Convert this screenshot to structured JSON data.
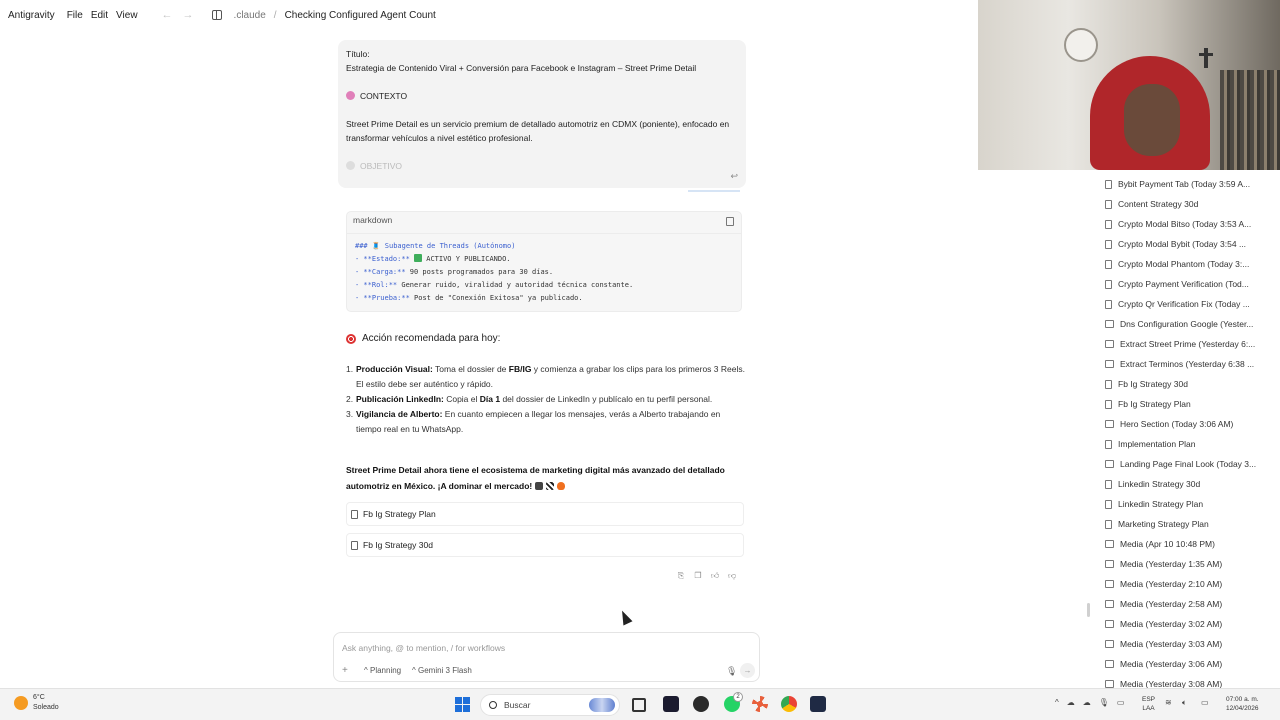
{
  "topbar": {
    "brand": "Antigravity",
    "menu": [
      "File",
      "Edit",
      "View"
    ],
    "breadcrumb_root": ".claude",
    "breadcrumb_sep": "/",
    "breadcrumb_current": "Checking Configured Agent Count"
  },
  "prompt": {
    "title_label": "Título:",
    "title_text": "Estrategia de Contenido Viral + Conversión para Facebook e Instagram – Street Prime Detail",
    "context_label": "CONTEXTO",
    "context_text": "Street Prime Detail es un servicio premium de detallado automotriz en CDMX (poniente), enfocado en transformar vehículos a nivel estético profesional.",
    "next_label": "OBJETIVO"
  },
  "code_block": {
    "lang": "markdown",
    "line1": "### 🧵 Subagente de Threads (Autónomo)",
    "line2_key": "- **Estado:**",
    "line2_val": " ACTIVO Y PUBLICANDO.",
    "line3_key": "- **Carga:**",
    "line3_val": " 90 posts programados para 30 días.",
    "line4_key": "- **Rol:**",
    "line4_val": " Generar ruido, viralidad y autoridad técnica constante.",
    "line5_key": "- **Prueba:**",
    "line5_val": " Post de \"Conexión Exitosa\" ya publicado."
  },
  "action": {
    "heading": "Acción recomendada para hoy:",
    "steps": [
      {
        "num": "1.",
        "bold": "Producción Visual:",
        "pre": " Toma el dossier de ",
        "bold2": "FB/IG",
        "post": " y comienza a grabar los clips para los primeros 3 Reels. El estilo debe ser auténtico y rápido."
      },
      {
        "num": "2.",
        "bold": "Publicación LinkedIn:",
        "pre": " Copia el ",
        "bold2": "Día 1",
        "post": " del dossier de LinkedIn y publícalo en tu perfil personal."
      },
      {
        "num": "3.",
        "bold": "Vigilancia de Alberto:",
        "pre": " En cuanto empiecen a llegar los mensajes, verás a Alberto trabajando en tiempo real en tu WhatsApp.",
        "bold2": "",
        "post": ""
      }
    ],
    "closing": "Street Prime Detail ahora tiene el ecosistema de marketing digital más avanzado del detallado automotriz en México. ¡A dominar el mercado!"
  },
  "files": [
    "Fb Ig Strategy Plan",
    "Fb Ig Strategy 30d"
  ],
  "composer": {
    "placeholder": "Ask anything, @ to mention, / for workflows",
    "mode": "Planning",
    "model": "Gemini 3 Flash"
  },
  "sidebar": {
    "items": [
      {
        "label": "Bybit Payment Tab (Today 3:59 A...",
        "type": "doc"
      },
      {
        "label": "Content Strategy 30d",
        "type": "doc"
      },
      {
        "label": "Crypto Modal Bitso (Today 3:53 A...",
        "type": "doc"
      },
      {
        "label": "Crypto Modal Bybit (Today 3:54 ...",
        "type": "doc"
      },
      {
        "label": "Crypto Modal Phantom (Today 3:...",
        "type": "doc"
      },
      {
        "label": "Crypto Payment Verification (Tod...",
        "type": "doc"
      },
      {
        "label": "Crypto Qr Verification Fix (Today ...",
        "type": "doc"
      },
      {
        "label": "Dns Configuration Google (Yester...",
        "type": "media"
      },
      {
        "label": "Extract Street Prime (Yesterday 6:...",
        "type": "media"
      },
      {
        "label": "Extract Terminos (Yesterday 6:38 ...",
        "type": "media"
      },
      {
        "label": "Fb Ig Strategy 30d",
        "type": "doc"
      },
      {
        "label": "Fb Ig Strategy Plan",
        "type": "doc"
      },
      {
        "label": "Hero Section (Today 3:06 AM)",
        "type": "media"
      },
      {
        "label": "Implementation Plan",
        "type": "doc"
      },
      {
        "label": "Landing Page Final Look (Today 3...",
        "type": "media"
      },
      {
        "label": "Linkedin Strategy 30d",
        "type": "doc"
      },
      {
        "label": "Linkedin Strategy Plan",
        "type": "doc"
      },
      {
        "label": "Marketing Strategy Plan",
        "type": "doc"
      },
      {
        "label": "Media (Apr 10 10:48 PM)",
        "type": "media"
      },
      {
        "label": "Media (Yesterday 1:35 AM)",
        "type": "media"
      },
      {
        "label": "Media (Yesterday 2:10 AM)",
        "type": "media"
      },
      {
        "label": "Media (Yesterday 2:58 AM)",
        "type": "media"
      },
      {
        "label": "Media (Yesterday 3:02 AM)",
        "type": "media"
      },
      {
        "label": "Media (Yesterday 3:03 AM)",
        "type": "media"
      },
      {
        "label": "Media (Yesterday 3:06 AM)",
        "type": "media"
      },
      {
        "label": "Media (Yesterday 3:08 AM)",
        "type": "media"
      }
    ]
  },
  "taskbar": {
    "temperature": "6°C",
    "weather": "Soleado",
    "search_label": "Buscar",
    "lang_top": "ESP",
    "lang_bottom": "LAA",
    "time": "07:00 a. m.",
    "date": "12/04/2026",
    "badge_count": "2"
  },
  "colors": {
    "accent": "#3a5fcf",
    "start_blue": "#1e6fd9",
    "weather_orange": "#f59b22"
  }
}
